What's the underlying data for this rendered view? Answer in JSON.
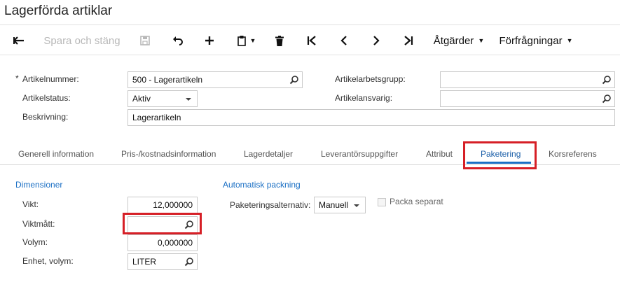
{
  "window": {
    "title": "Lagerförda artiklar"
  },
  "toolbar": {
    "save_close_label": "Spara och stäng",
    "actions_label": "Åtgärder",
    "inquiries_label": "Förfrågningar"
  },
  "form": {
    "item_number": {
      "label": "Artikelnummer:",
      "value": "500 - Lagerartikeln"
    },
    "item_status": {
      "label": "Artikelstatus:",
      "value": "Aktiv"
    },
    "description": {
      "label": "Beskrivning:",
      "value": "Lagerartikeln"
    },
    "item_work_group": {
      "label": "Artikelarbetsgrupp:",
      "value": ""
    },
    "item_responsible": {
      "label": "Artikelansvarig:",
      "value": ""
    },
    "required_marker": "*"
  },
  "tabs": [
    {
      "label": "Generell information"
    },
    {
      "label": "Pris-/kostnadsinformation"
    },
    {
      "label": "Lagerdetaljer"
    },
    {
      "label": "Leverantörsuppgifter"
    },
    {
      "label": "Attribut"
    },
    {
      "label": "Paketering"
    },
    {
      "label": "Korsreferens"
    }
  ],
  "packaging": {
    "dimensions_header": "Dimensioner",
    "weight": {
      "label": "Vikt:",
      "value": "12,000000"
    },
    "weight_unit": {
      "label": "Viktmått:",
      "value": ""
    },
    "volume": {
      "label": "Volym:",
      "value": "0,000000"
    },
    "volume_unit": {
      "label": "Enhet, volym:",
      "value": "LITER"
    },
    "auto_packing_header": "Automatisk packning",
    "packing_option": {
      "label": "Paketeringsalternativ:",
      "value": "Manuell"
    },
    "pack_separately": {
      "label": "Packa separat",
      "checked": false
    }
  },
  "colors": {
    "accent": "#1a6fc4",
    "highlight": "#d61f26"
  }
}
